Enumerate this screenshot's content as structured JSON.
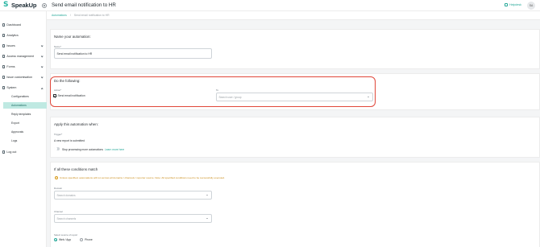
{
  "app": {
    "name": "SpeakUp"
  },
  "header": {
    "title": "Send email notification to HR",
    "workspace": "Helpdesk",
    "avatar_initials": "SA"
  },
  "breadcrumb": {
    "parent": "Automations",
    "separator": "/",
    "current": "Send email notification to HR"
  },
  "sidebar": {
    "items": [
      {
        "label": "Dashboard",
        "icon": "dashboard-icon"
      },
      {
        "label": "Analytics",
        "icon": "analytics-icon"
      },
      {
        "label": "Issues",
        "icon": "issues-icon",
        "expandable": true
      },
      {
        "label": "Access management",
        "icon": "access-icon",
        "expandable": true
      },
      {
        "label": "Forms",
        "icon": "forms-icon",
        "expandable": true
      },
      {
        "label": "Issue customisation",
        "icon": "customisation-icon",
        "expandable": true
      },
      {
        "label": "System",
        "icon": "system-icon",
        "expandable": true,
        "expanded": true
      }
    ],
    "system_subitems": [
      "Configurations",
      "Automations",
      "Reply templates",
      "Export",
      "Approvals",
      "Logs"
    ],
    "active_subitem": "Automations",
    "logout": "Log out"
  },
  "name_section": {
    "title": "Name your automation:",
    "name_label": "Name",
    "required_marker": "*",
    "name_value": "Send email notification to HR"
  },
  "do_section": {
    "title": "Do the following:",
    "action_label": "Action",
    "required_marker": "*",
    "action_value": "Send email notification",
    "action_icon": "mail-icon",
    "to_label": "To",
    "to_placeholder": "Search user / group"
  },
  "apply_section": {
    "title": "Apply this automation when:",
    "trigger_label": "Trigger",
    "required_marker": "*",
    "trigger_value": "A new report is submitted",
    "stop_label": "Stop processing more automations",
    "stop_enabled": false,
    "learn_more": "Learn more here"
  },
  "conditions_section": {
    "title": "If all these conditions match",
    "warning": "Unless specified, automations will run across all domains / channels / reporter source. Note: All specified conditions need to be successfully executed.",
    "domain_label": "Domain",
    "domain_placeholder": "Search domains",
    "channel_label": "Channel",
    "channel_placeholder": "Search channels",
    "source_label": "Select source of report",
    "sources": [
      "Web / App",
      "Phone"
    ],
    "selected_source": "Web / App"
  },
  "colors": {
    "accent": "#26a898",
    "highlight": "#e0473a",
    "warning": "#c98a14",
    "active_nav_bg": "#bfe9e2"
  }
}
